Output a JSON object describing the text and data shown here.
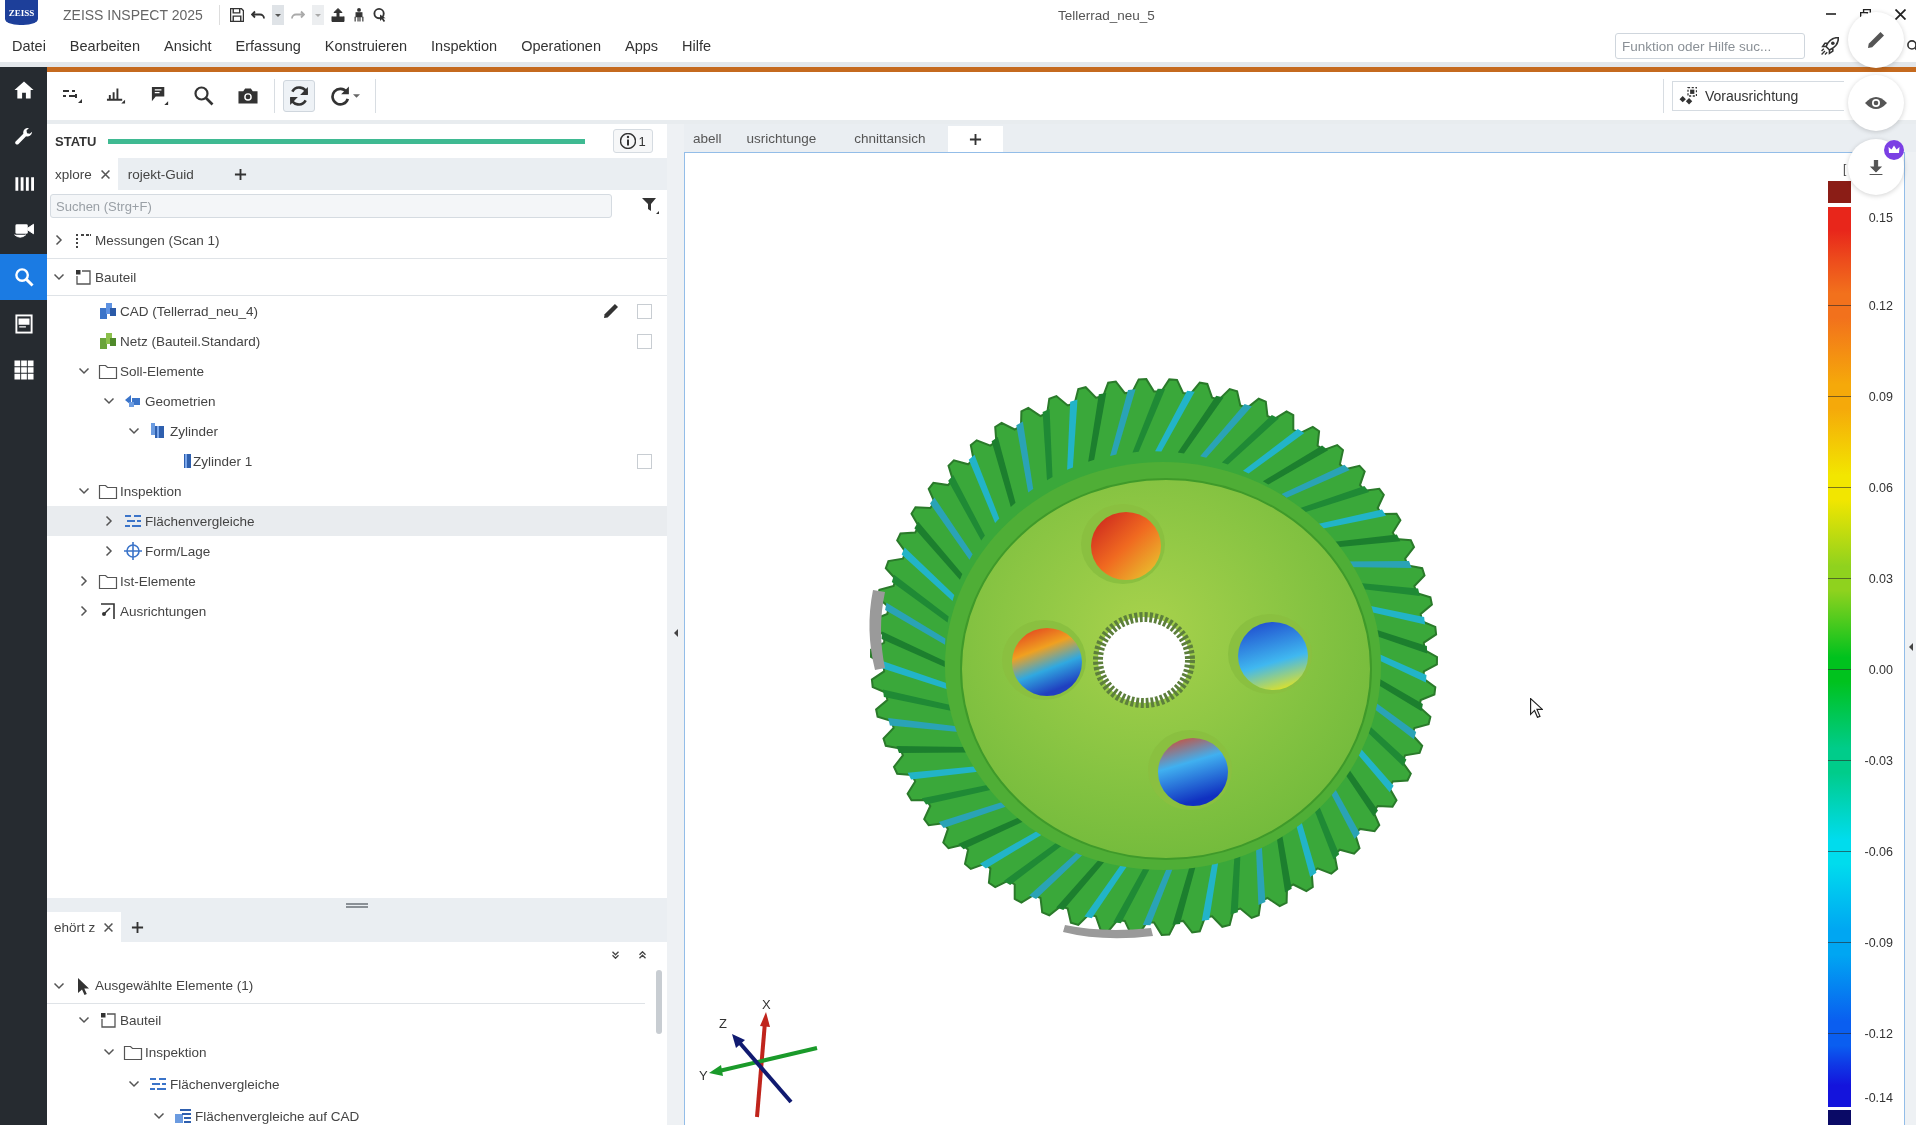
{
  "app": {
    "logo": "ZEISS",
    "name": "ZEISS INSPECT 2025",
    "document": "Tellerrad_neu_5"
  },
  "menu": [
    "Datei",
    "Bearbeiten",
    "Ansicht",
    "Erfassung",
    "Konstruieren",
    "Inspektion",
    "Operationen",
    "Apps",
    "Hilfe"
  ],
  "help_search": {
    "placeholder": "Funktion oder Hilfe suc..."
  },
  "toolbar": {
    "alignment": "Vorausrichtung"
  },
  "sidebar": {
    "items": [
      {
        "selected": false
      },
      {
        "selected": false
      },
      {
        "selected": false
      },
      {
        "selected": false
      },
      {
        "selected": true
      },
      {
        "selected": false
      },
      {
        "selected": false
      }
    ]
  },
  "status": {
    "label": "STATU",
    "level": 1,
    "info_count": "1"
  },
  "explorer": {
    "tabs": [
      {
        "label": "xplore",
        "selected": true
      },
      {
        "label": "rojekt-Guid",
        "selected": false
      }
    ],
    "search": {
      "placeholder": "Suchen (Strg+F)"
    },
    "tree": [
      {
        "label": "Messungen (Scan 1)",
        "kind": "measurements",
        "expanded": false,
        "selected": false
      },
      {
        "label": "Bauteil",
        "kind": "part",
        "expanded": true,
        "selected": false,
        "children": [
          {
            "label": "CAD (Tellerrad_neu_4)",
            "kind": "cad",
            "selected": false,
            "editing": true,
            "checked": false
          },
          {
            "label": "Netz (Bauteil.Standard)",
            "kind": "mesh",
            "selected": false,
            "checked": false
          },
          {
            "label": "Soll-Elemente",
            "kind": "folder",
            "expanded": true,
            "selected": false,
            "children": [
              {
                "label": "Geometrien",
                "kind": "geometries",
                "expanded": true,
                "selected": false,
                "children": [
                  {
                    "label": "Zylinder",
                    "kind": "cylinders",
                    "expanded": true,
                    "selected": false,
                    "children": [
                      {
                        "label": "Zylinder 1",
                        "kind": "cylinder",
                        "selected": false,
                        "checked": false
                      }
                    ]
                  }
                ]
              }
            ]
          },
          {
            "label": "Inspektion",
            "kind": "folder",
            "expanded": true,
            "selected": false,
            "children": [
              {
                "label": "Flächenvergleiche",
                "kind": "comparisons",
                "expanded": false,
                "selected": true
              },
              {
                "label": "Form/Lage",
                "kind": "form",
                "expanded": false,
                "selected": false
              }
            ]
          },
          {
            "label": "Ist-Elemente",
            "kind": "folder",
            "expanded": false,
            "selected": false
          },
          {
            "label": "Ausrichtungen",
            "kind": "alignments",
            "expanded": false,
            "selected": false
          }
        ]
      }
    ]
  },
  "selection": {
    "tabs": [
      {
        "label": "ehört z",
        "selected": true
      }
    ],
    "tree": [
      {
        "label": "Ausgewählte Elemente (1)",
        "kind": "selection",
        "expanded": true,
        "selected": false,
        "children": [
          {
            "label": "Bauteil",
            "kind": "part",
            "expanded": true,
            "selected": false,
            "children": [
              {
                "label": "Inspektion",
                "kind": "folder",
                "expanded": true,
                "selected": false,
                "children": [
                  {
                    "label": "Flächenvergleiche",
                    "kind": "comparisons",
                    "expanded": true,
                    "selected": false,
                    "children": [
                      {
                        "label": "Flächenvergleiche auf CAD",
                        "kind": "surface-comparison",
                        "expanded": true,
                        "selected": false
                      }
                    ]
                  }
                ]
              }
            ]
          }
        ]
      }
    ]
  },
  "viewport": {
    "tabs": [
      {
        "label": "abell",
        "selected": false
      },
      {
        "label": "usrichtunge",
        "selected": false
      },
      {
        "label": "chnittansich",
        "selected": false
      }
    ],
    "axes": {
      "x": "X",
      "y": "Y",
      "z": "Z"
    },
    "color_scale": {
      "unit": "[",
      "stops": [
        {
          "label": "0.15",
          "color": "#e8261b"
        },
        {
          "label": "0.12",
          "color": "#f2711c"
        },
        {
          "label": "0.09",
          "color": "#f5a90a"
        },
        {
          "label": "0.06",
          "color": "#f2e600"
        },
        {
          "label": "0.03",
          "color": "#8fd21e"
        },
        {
          "label": "0.00",
          "color": "#00c21e"
        },
        {
          "label": "-0.03",
          "color": "#00cc8a"
        },
        {
          "label": "-0.06",
          "color": "#00dced"
        },
        {
          "label": "-0.09",
          "color": "#00a6f2"
        },
        {
          "label": "-0.12",
          "color": "#0a5ef0"
        },
        {
          "label": "-0.14",
          "color": "#1414dc"
        }
      ]
    }
  }
}
